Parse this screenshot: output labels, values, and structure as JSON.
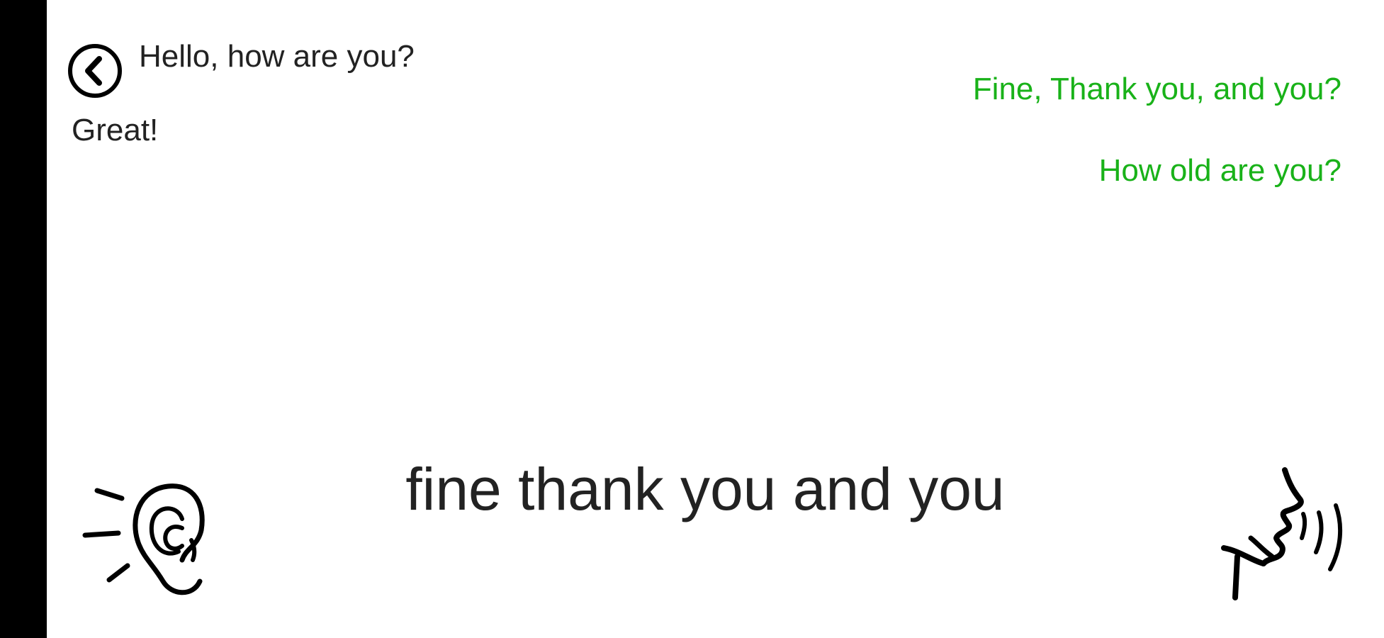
{
  "conversation": {
    "messages": [
      {
        "side": "left",
        "text": "Hello, how are you?"
      },
      {
        "side": "left",
        "text": "Great!"
      },
      {
        "side": "right",
        "text": "Fine, Thank you, and you?"
      },
      {
        "side": "right",
        "text": "How old are you?"
      }
    ]
  },
  "transcript": {
    "text": "fine thank you and you"
  },
  "icons": {
    "back": "back-arrow-circle-icon",
    "listen": "ear-icon",
    "speak": "speaking-face-icon"
  },
  "colors": {
    "left_message": "#222222",
    "right_message": "#19b219",
    "side_bar": "#000000",
    "background": "#ffffff"
  }
}
